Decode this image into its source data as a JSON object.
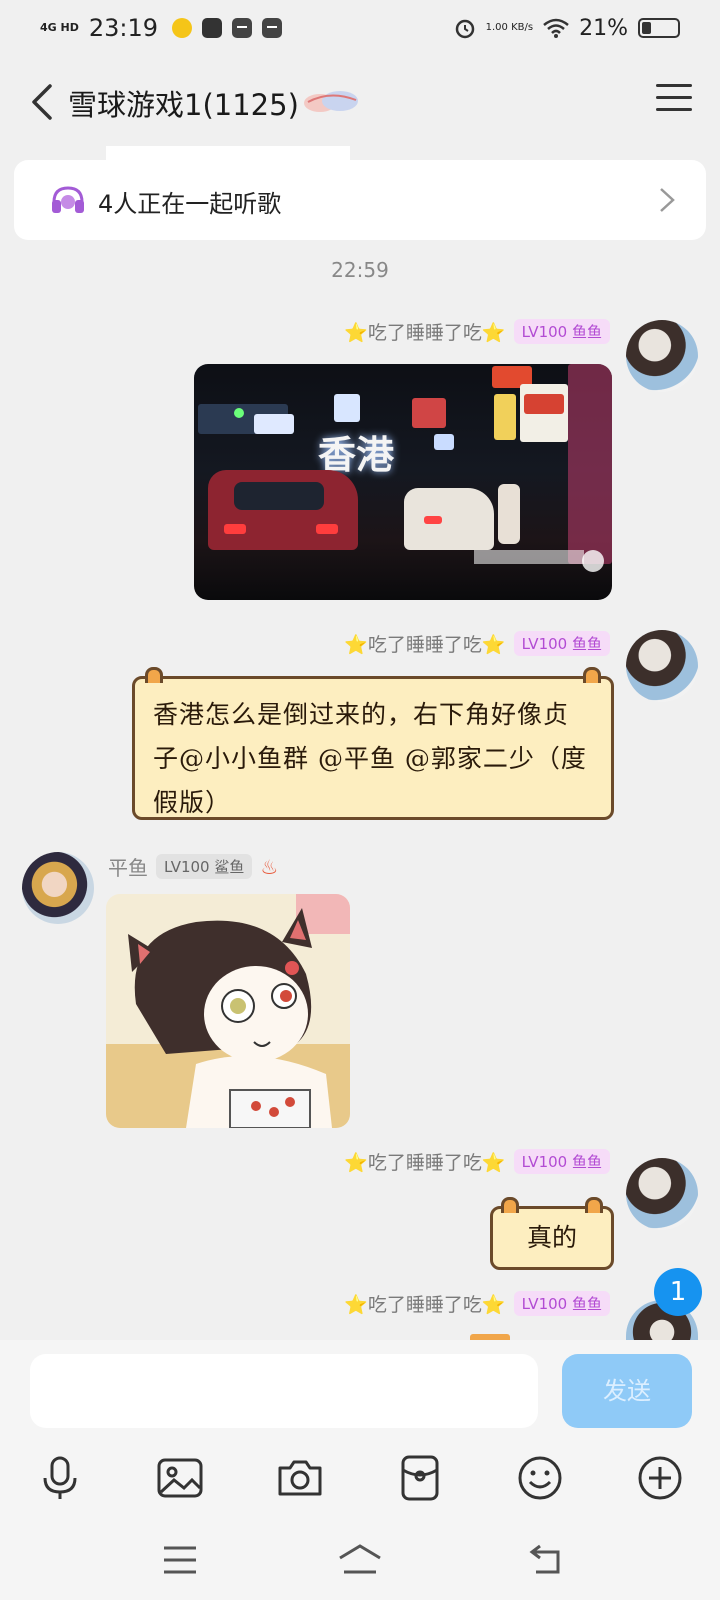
{
  "status": {
    "network": "4G HD",
    "time": "23:19",
    "speed": "1.00 KB/s",
    "battery": "21%"
  },
  "header": {
    "title": "雪球游戏1(1125)"
  },
  "listen": {
    "text": "4人正在一起听歌"
  },
  "time_label": "22:59",
  "messages": [
    {
      "sender": "⭐吃了睡睡了吃⭐",
      "level": "LV100",
      "title": "鱼鱼",
      "type": "image"
    },
    {
      "sender": "⭐吃了睡睡了吃⭐",
      "level": "LV100",
      "title": "鱼鱼",
      "type": "text",
      "text": "香港怎么是倒过来的，右下角好像贞子@小小鱼群 @平鱼 @郭家二少（度假版）"
    },
    {
      "sender": "平鱼",
      "level": "LV100",
      "title": "鲨鱼",
      "type": "image"
    },
    {
      "sender": "⭐吃了睡睡了吃⭐",
      "level": "LV100",
      "title": "鱼鱼",
      "type": "text",
      "text": "真的"
    },
    {
      "sender": "⭐吃了睡睡了吃⭐",
      "level": "LV100",
      "title": "鱼鱼",
      "type": "partial"
    }
  ],
  "image_caption": "香港",
  "unread_count": "1",
  "input": {
    "placeholder": "",
    "send_label": "发送"
  },
  "toolbar": [
    "microphone-icon",
    "image-icon",
    "camera-icon",
    "red-packet-icon",
    "emoji-icon",
    "plus-icon"
  ],
  "colors": {
    "accent": "#1693f0",
    "send_disabled": "#8fcaf7",
    "level_badge": "#b24bd3",
    "bubble_fill": "#fdeec0"
  }
}
